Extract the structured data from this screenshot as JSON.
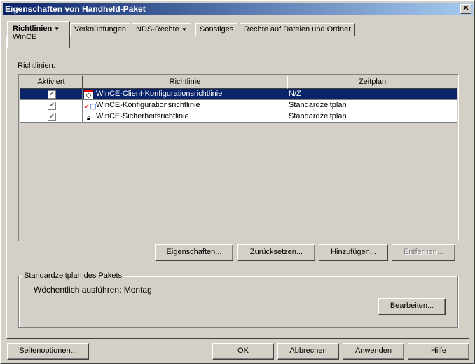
{
  "title": "Eigenschaften von Handheld-Paket",
  "tabs": [
    {
      "label": "Richtlinien",
      "sub": "WinCE"
    },
    {
      "label": "Verknüpfungen"
    },
    {
      "label": "NDS-Rechte"
    },
    {
      "label": "Sonstiges"
    },
    {
      "label": "Rechte auf Dateien und Ordner"
    }
  ],
  "list_label": "Richtlinien:",
  "columns": [
    "Aktiviert",
    "Richtlinie",
    "Zeitplan"
  ],
  "rows": [
    {
      "enabled": true,
      "icon": "client-config-icon",
      "name": "WinCE-Client-Konfigurationsrichtlinie",
      "schedule": "N/Z"
    },
    {
      "enabled": true,
      "icon": "device-config-icon",
      "name": "WinCE-Konfigurationsrichtlinie",
      "schedule": "Standardzeitplan"
    },
    {
      "enabled": true,
      "icon": "lock-icon",
      "name": "WinCE-Sicherheitsrichtlinie",
      "schedule": "Standardzeitplan"
    }
  ],
  "buttons": {
    "properties": "Eigenschaften...",
    "reset": "Zurücksetzen...",
    "add": "Hinzufügen...",
    "remove": "Entfernen..."
  },
  "schedule_group": {
    "label": "Standardzeitplan des Pakets",
    "text": "Wöchentlich ausführen: Montag",
    "edit": "Bearbeiten..."
  },
  "footer": {
    "page_options": "Seitenoptionen...",
    "ok": "OK",
    "cancel": "Abbrechen",
    "apply": "Anwenden",
    "help": "Hilfe"
  }
}
